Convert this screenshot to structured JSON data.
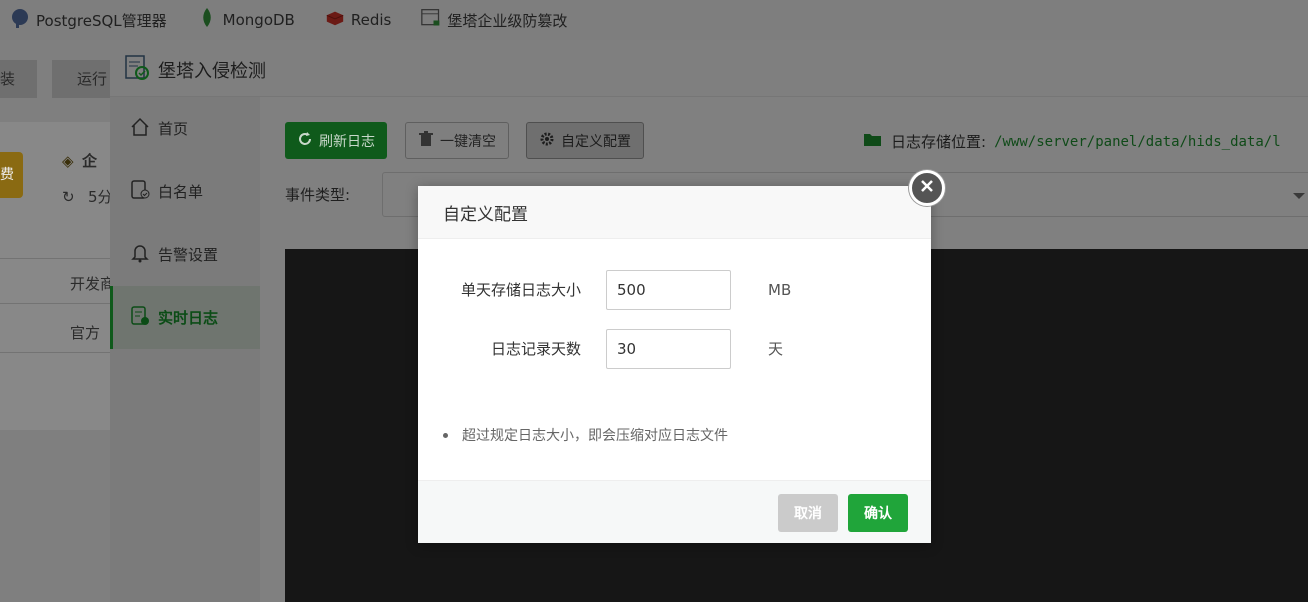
{
  "topbar": {
    "plugins": [
      {
        "label": "PostgreSQL管理器",
        "icon": "elephant-icon"
      },
      {
        "label": "MongoDB",
        "icon": "leaf-icon"
      },
      {
        "label": "Redis",
        "icon": "redis-icon"
      },
      {
        "label": "堡塔企业级防篡改",
        "icon": "lock-window-icon"
      }
    ]
  },
  "background": {
    "tab_1": "装",
    "tab_2": "运行",
    "badge_text": "企",
    "time_text": "5分",
    "btn_text": "费",
    "row_1": "开发商",
    "row_2": "官方"
  },
  "window": {
    "title": "堡塔入侵检测",
    "sidebar": [
      {
        "label": "首页",
        "icon": "home-icon"
      },
      {
        "label": "白名单",
        "icon": "whitelist-icon"
      },
      {
        "label": "告警设置",
        "icon": "bell-icon"
      },
      {
        "label": "实时日志",
        "icon": "realtime-log-icon"
      }
    ],
    "toolbar": {
      "refresh": "刷新日志",
      "clear": "一键清空",
      "config": "自定义配置"
    },
    "log_path_label": "日志存储位置:",
    "log_path_value": "/www/server/panel/data/hids_data/l",
    "filter_label": "事件类型:"
  },
  "modal": {
    "title": "自定义配置",
    "fields": [
      {
        "label": "单天存储日志大小",
        "value": "500",
        "unit": "MB"
      },
      {
        "label": "日志记录天数",
        "value": "30",
        "unit": "天"
      }
    ],
    "tip": "超过规定日志大小，即会压缩对应日志文件",
    "cancel": "取消",
    "confirm": "确认"
  },
  "colors": {
    "accent_green": "#20a53a",
    "cancel_gray": "#cbcbcb",
    "overlay": "#7f7f7f"
  }
}
